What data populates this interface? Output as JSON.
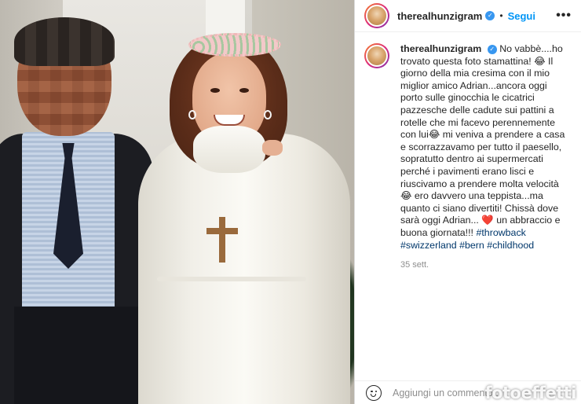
{
  "post": {
    "username": "therealhunzigram",
    "follow_label": "Segui",
    "separator": "•",
    "more_icon": "more-options-icon",
    "verified_icon": "verified-badge-icon"
  },
  "caption": {
    "username": "therealhunzigram",
    "text_1": "No vabbè....ho trovato questa foto stamattina! 😂 Il giorno della mia cresima con il mio miglior amico Adrian...ancora oggi porto sulle ginocchia le cicatrici pazzesche delle cadute sui pattini a rotelle che mi facevo perennemente con lui😂 mi veniva a prendere a casa e scorrazzavamo per tutto il paesello, sopratutto dentro ai supermercati perché i pavimenti erano lisci e riuscivamo a prendere molta velocità 😂 ero davvero una teppista...ma quanto ci siano divertiti! Chissà dove sarà oggi Adrian... ❤️ un abbraccio e buona giornata!!!",
    "hashtags": "#throwback #swizzerland #bern #childhood",
    "time_ago": "35 sett."
  },
  "comment_box": {
    "placeholder": "Aggiungi un commento...",
    "emoji_icon": "emoji-icon"
  },
  "watermark": "fotoeffetti",
  "colors": {
    "link_blue": "#0095f6",
    "hashtag": "#00376b",
    "verified": "#3897f0",
    "muted": "#8e8e8e"
  }
}
